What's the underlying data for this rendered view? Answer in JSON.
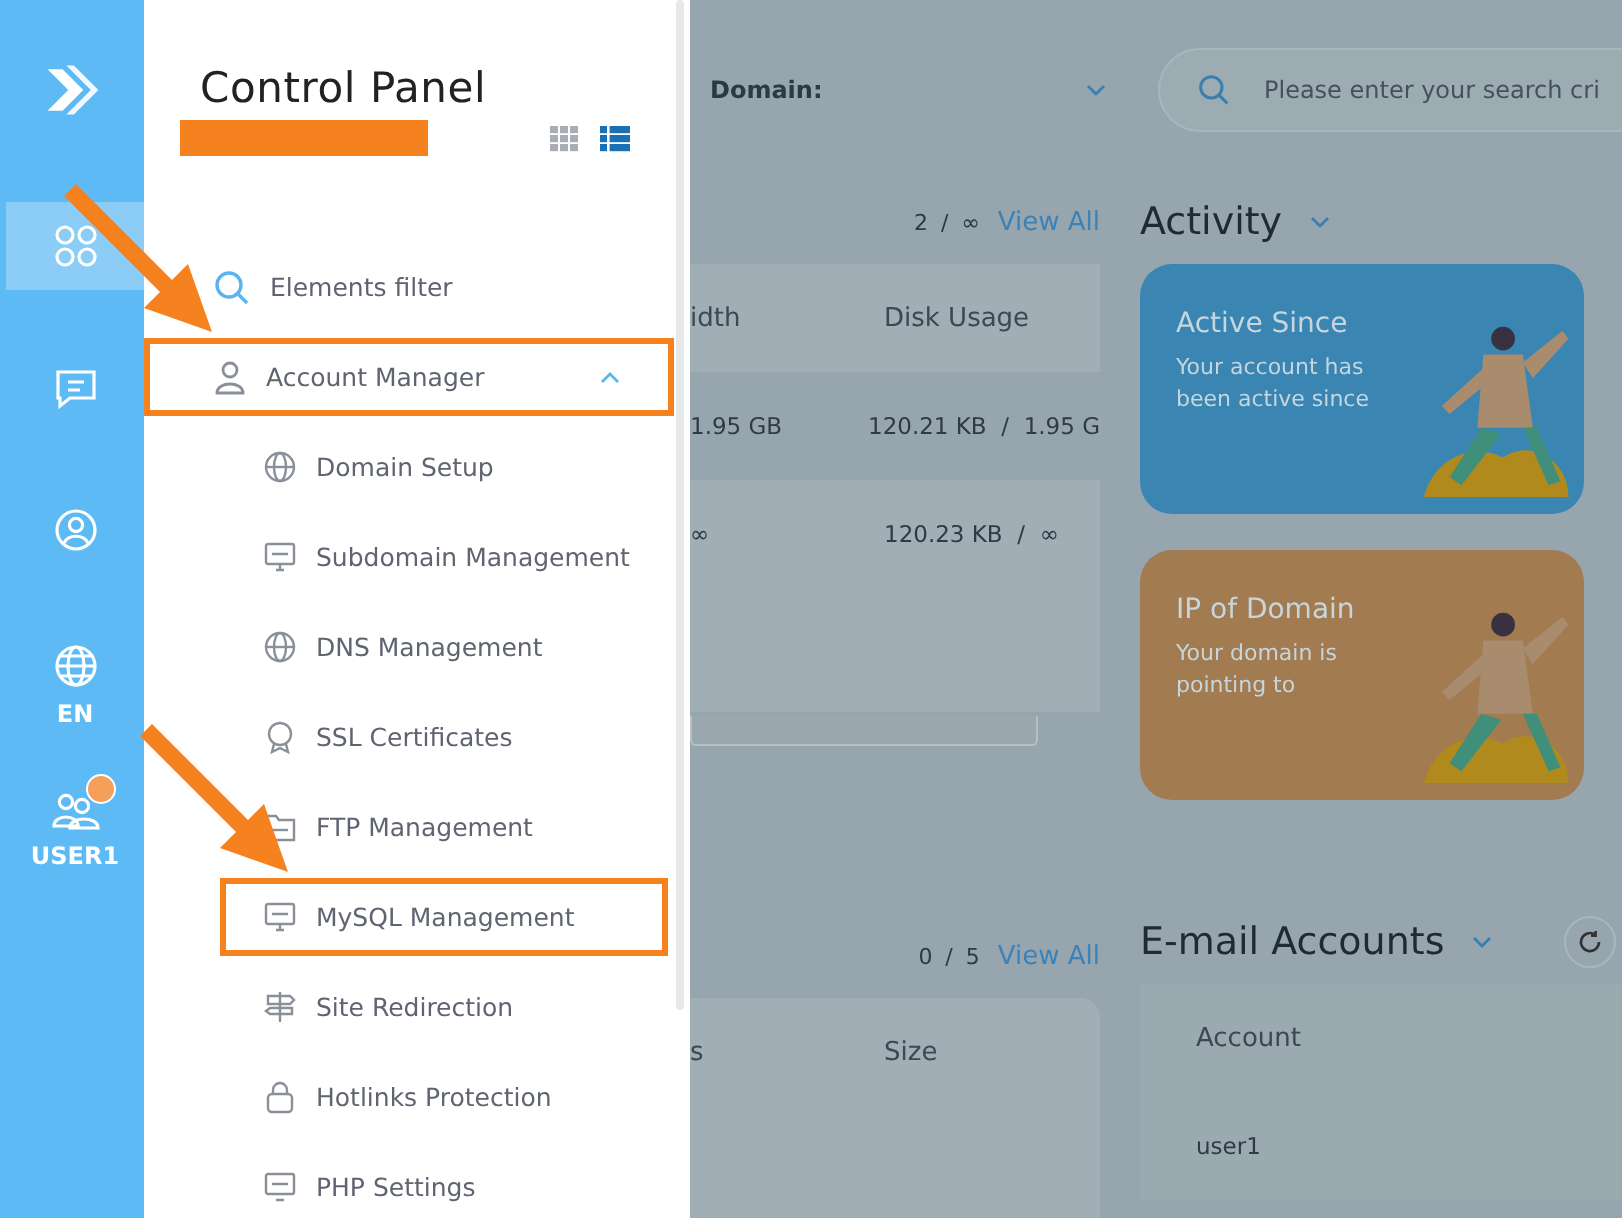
{
  "rail": {
    "items": [
      {
        "selected": true
      },
      {
        "selected": false
      },
      {
        "selected": false
      },
      {
        "label": "EN",
        "selected": false
      },
      {
        "label": "USER1",
        "badge": true,
        "selected": false
      }
    ]
  },
  "panel": {
    "title": "Control Panel",
    "redacted": true,
    "views": [
      {
        "kind": "grid",
        "selected": false
      },
      {
        "kind": "list",
        "selected": true
      }
    ],
    "menu": [
      {
        "kind": "filter",
        "label": "Elements filter",
        "highlighted": false
      },
      {
        "kind": "group",
        "label": "Account Manager",
        "expanded": true,
        "highlighted": true,
        "children": [
          {
            "label": "Domain Setup",
            "highlighted": false
          },
          {
            "label": "Subdomain Management",
            "highlighted": false
          },
          {
            "label": "DNS Management",
            "highlighted": false
          },
          {
            "label": "SSL Certificates",
            "highlighted": false
          },
          {
            "label": "FTP Management",
            "highlighted": false
          },
          {
            "label": "MySQL Management",
            "highlighted": true
          },
          {
            "label": "Site Redirection",
            "highlighted": false
          },
          {
            "label": "Hotlinks Protection",
            "highlighted": false
          },
          {
            "label": "PHP Settings",
            "highlighted": false
          }
        ]
      }
    ]
  },
  "dashboard": {
    "domain_label": "Domain:",
    "search": {
      "placeholder": "Please enter your search cri"
    },
    "left_sections": [
      {
        "count": "2 / ∞",
        "link": "View All",
        "columns": [
          "idth",
          "Disk Usage"
        ],
        "rows": [
          [
            "1.95 GB",
            "120.21 KB  /  1.95 G"
          ],
          [
            "∞",
            "120.23 KB  /  ∞"
          ]
        ]
      },
      {
        "count": "0 / 5",
        "link": "View All",
        "columns": [
          "s",
          "Size"
        ]
      }
    ],
    "activity": {
      "title": "Activity",
      "cards": [
        {
          "title": "Active Since",
          "text": "Your account has been active since",
          "color": "#3a85b2"
        },
        {
          "title": "IP of Domain",
          "text": "Your domain is pointing to",
          "color": "#a27b50"
        }
      ]
    },
    "email": {
      "title": "E-mail Accounts",
      "columns": [
        "Account"
      ],
      "rows": [
        [
          "user1"
        ]
      ]
    }
  }
}
